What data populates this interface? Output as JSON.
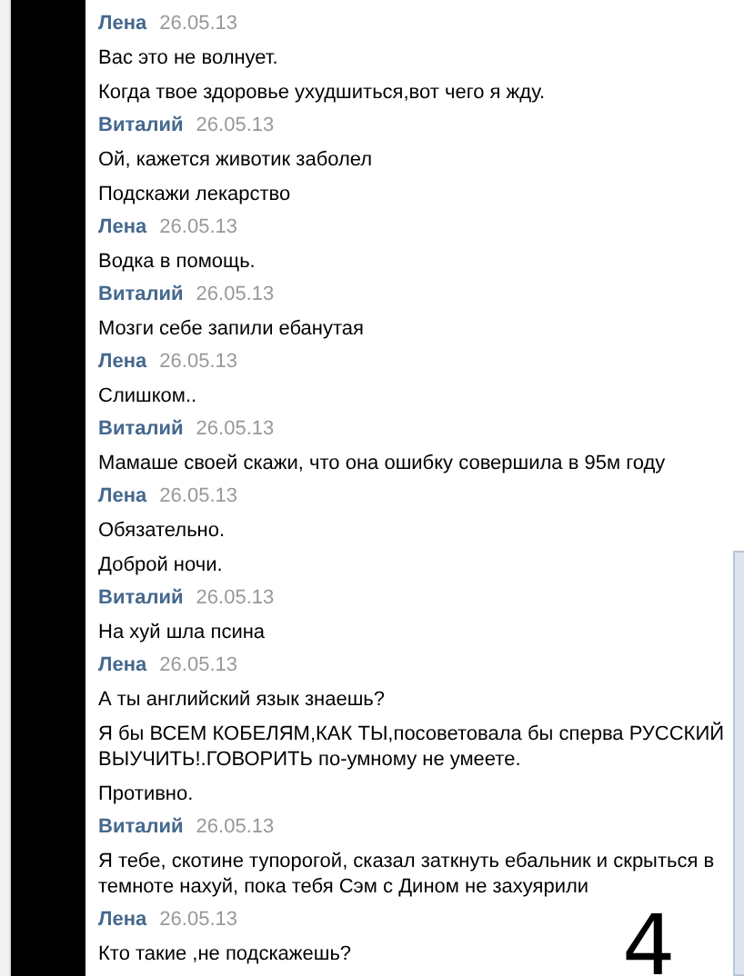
{
  "groups": [
    {
      "author": "Лена",
      "date": "26.05.13",
      "messages": [
        "Вас это не волнует.",
        "Когда твое здоровье ухудшиться,вот чего я жду."
      ]
    },
    {
      "author": "Виталий",
      "date": "26.05.13",
      "messages": [
        "Ой, кажется животик заболел",
        "Подскажи лекарство"
      ]
    },
    {
      "author": "Лена",
      "date": "26.05.13",
      "messages": [
        "Водка в помощь."
      ]
    },
    {
      "author": "Виталий",
      "date": "26.05.13",
      "messages": [
        "Мозги себе запили ебанутая"
      ]
    },
    {
      "author": "Лена",
      "date": "26.05.13",
      "messages": [
        "Слишком.."
      ]
    },
    {
      "author": "Виталий",
      "date": "26.05.13",
      "messages": [
        "Мамаше своей скажи, что она ошибку совершила в 95м году"
      ]
    },
    {
      "author": "Лена",
      "date": "26.05.13",
      "messages": [
        "Обязательно.",
        "Доброй ночи."
      ]
    },
    {
      "author": "Виталий",
      "date": "26.05.13",
      "messages": [
        "На хуй шла псина"
      ]
    },
    {
      "author": "Лена",
      "date": "26.05.13",
      "messages": [
        "А ты английский язык знаешь?",
        "Я бы ВСЕМ КОБЕЛЯМ,КАК ТЫ,посоветовала бы сперва РУССКИЙ ВЫУЧИТЬ!.ГОВОРИТЬ по-умному не умеете.",
        "Противно."
      ]
    },
    {
      "author": "Виталий",
      "date": "26.05.13",
      "messages": [
        "Я тебе, скотине тупорогой, сказал заткнуть ебальник и скрыться в темноте нахуй, пока тебя Сэм с Дином не захуярили"
      ]
    },
    {
      "author": "Лена",
      "date": "26.05.13",
      "messages": [
        "Кто такие ,не подскажешь?"
      ]
    }
  ],
  "annotation": "4"
}
